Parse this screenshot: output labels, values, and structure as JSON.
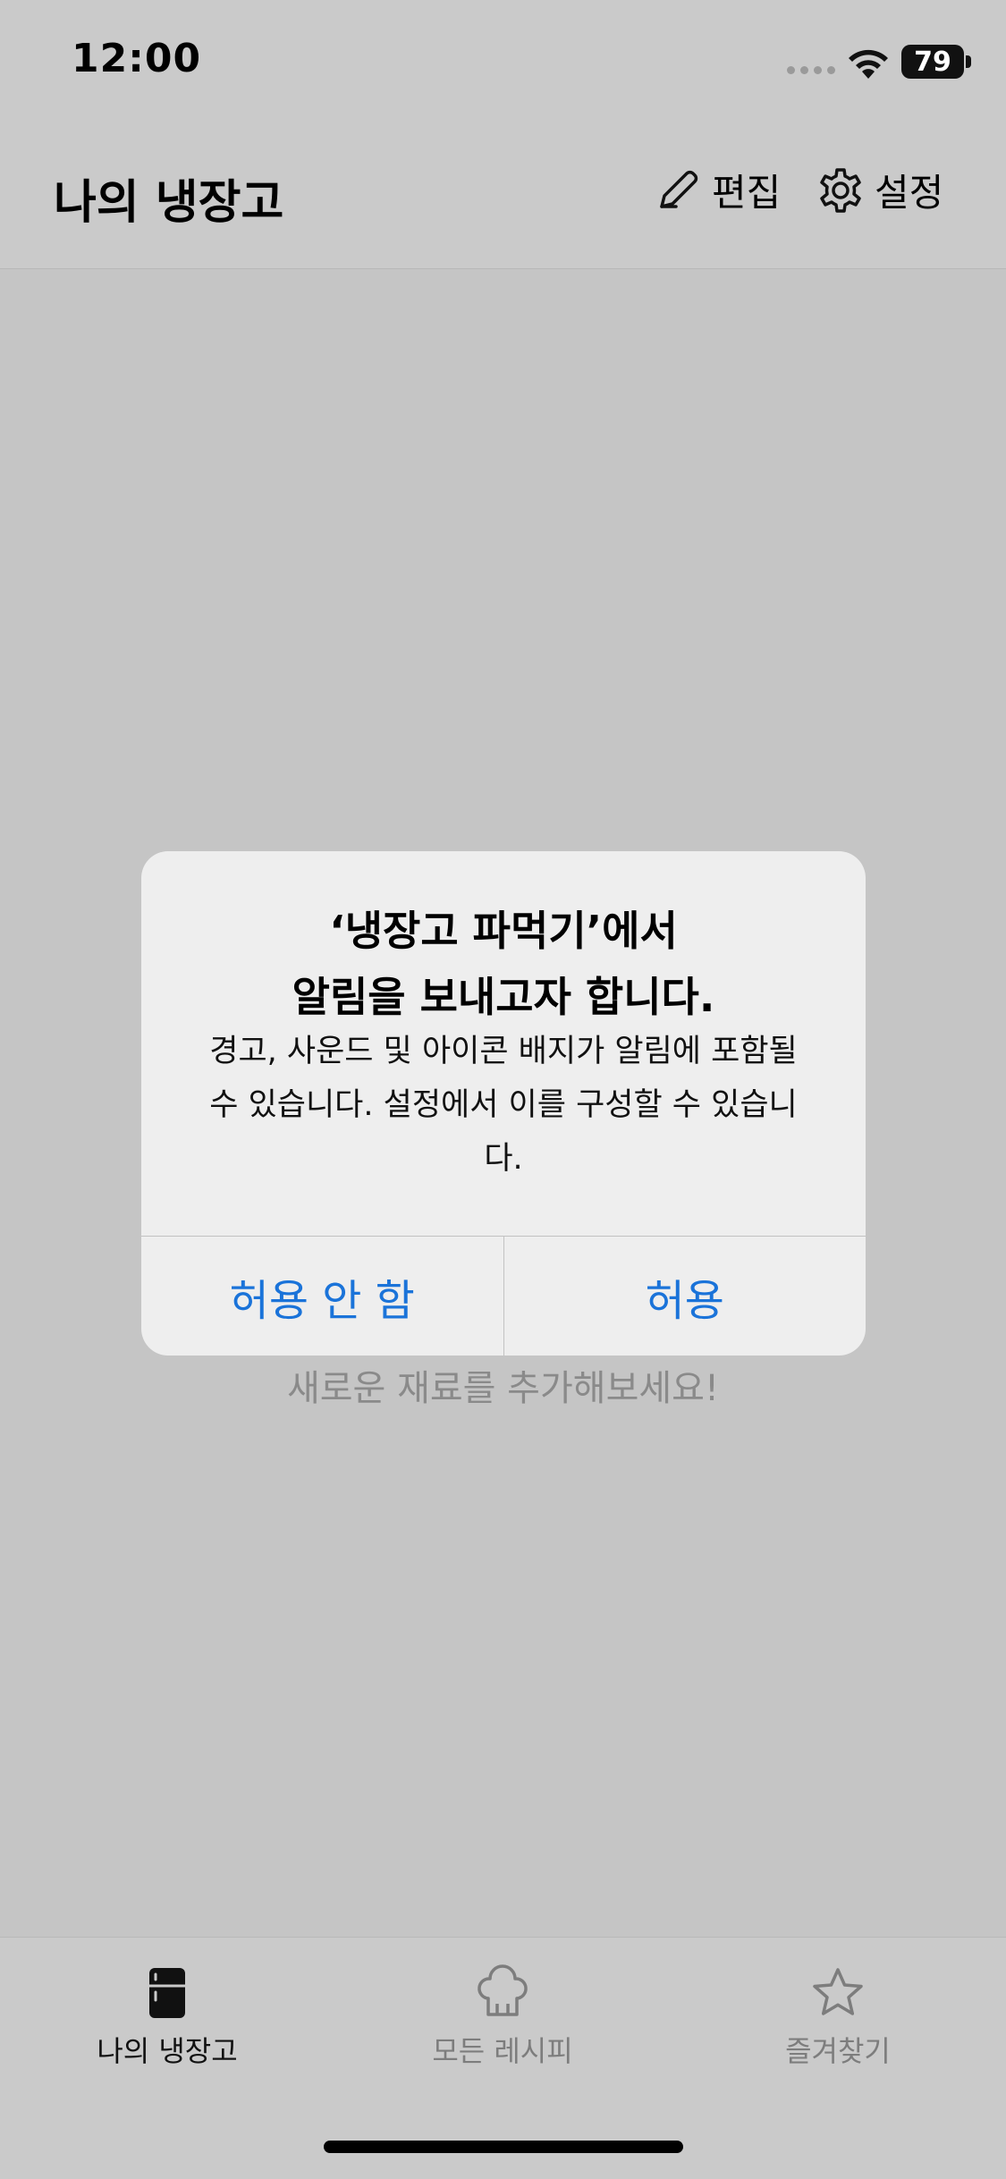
{
  "status_bar": {
    "time": "12:00",
    "battery_level": "79"
  },
  "nav": {
    "title": "나의 냉장고",
    "edit_label": "편집",
    "settings_label": "설정"
  },
  "main": {
    "empty_message": "새로운 재료를 추가해보세요!"
  },
  "alert": {
    "title_line1": "‘냉장고 파먹기’에서",
    "title_line2": "알림을 보내고자 합니다.",
    "message": "경고, 사운드 및 아이콘 배지가 알림에 포함될 수 있습니다. 설정에서 이를 구성할 수 있습니다.",
    "deny_label": "허용 안 함",
    "allow_label": "허용",
    "button_color": "#1a73d9"
  },
  "tab_bar": {
    "items": [
      {
        "label": "나의 냉장고",
        "icon": "fridge-icon",
        "active": true
      },
      {
        "label": "모든 레시피",
        "icon": "chef-hat-icon",
        "active": false
      },
      {
        "label": "즐겨찾기",
        "icon": "star-icon",
        "active": false
      }
    ]
  }
}
